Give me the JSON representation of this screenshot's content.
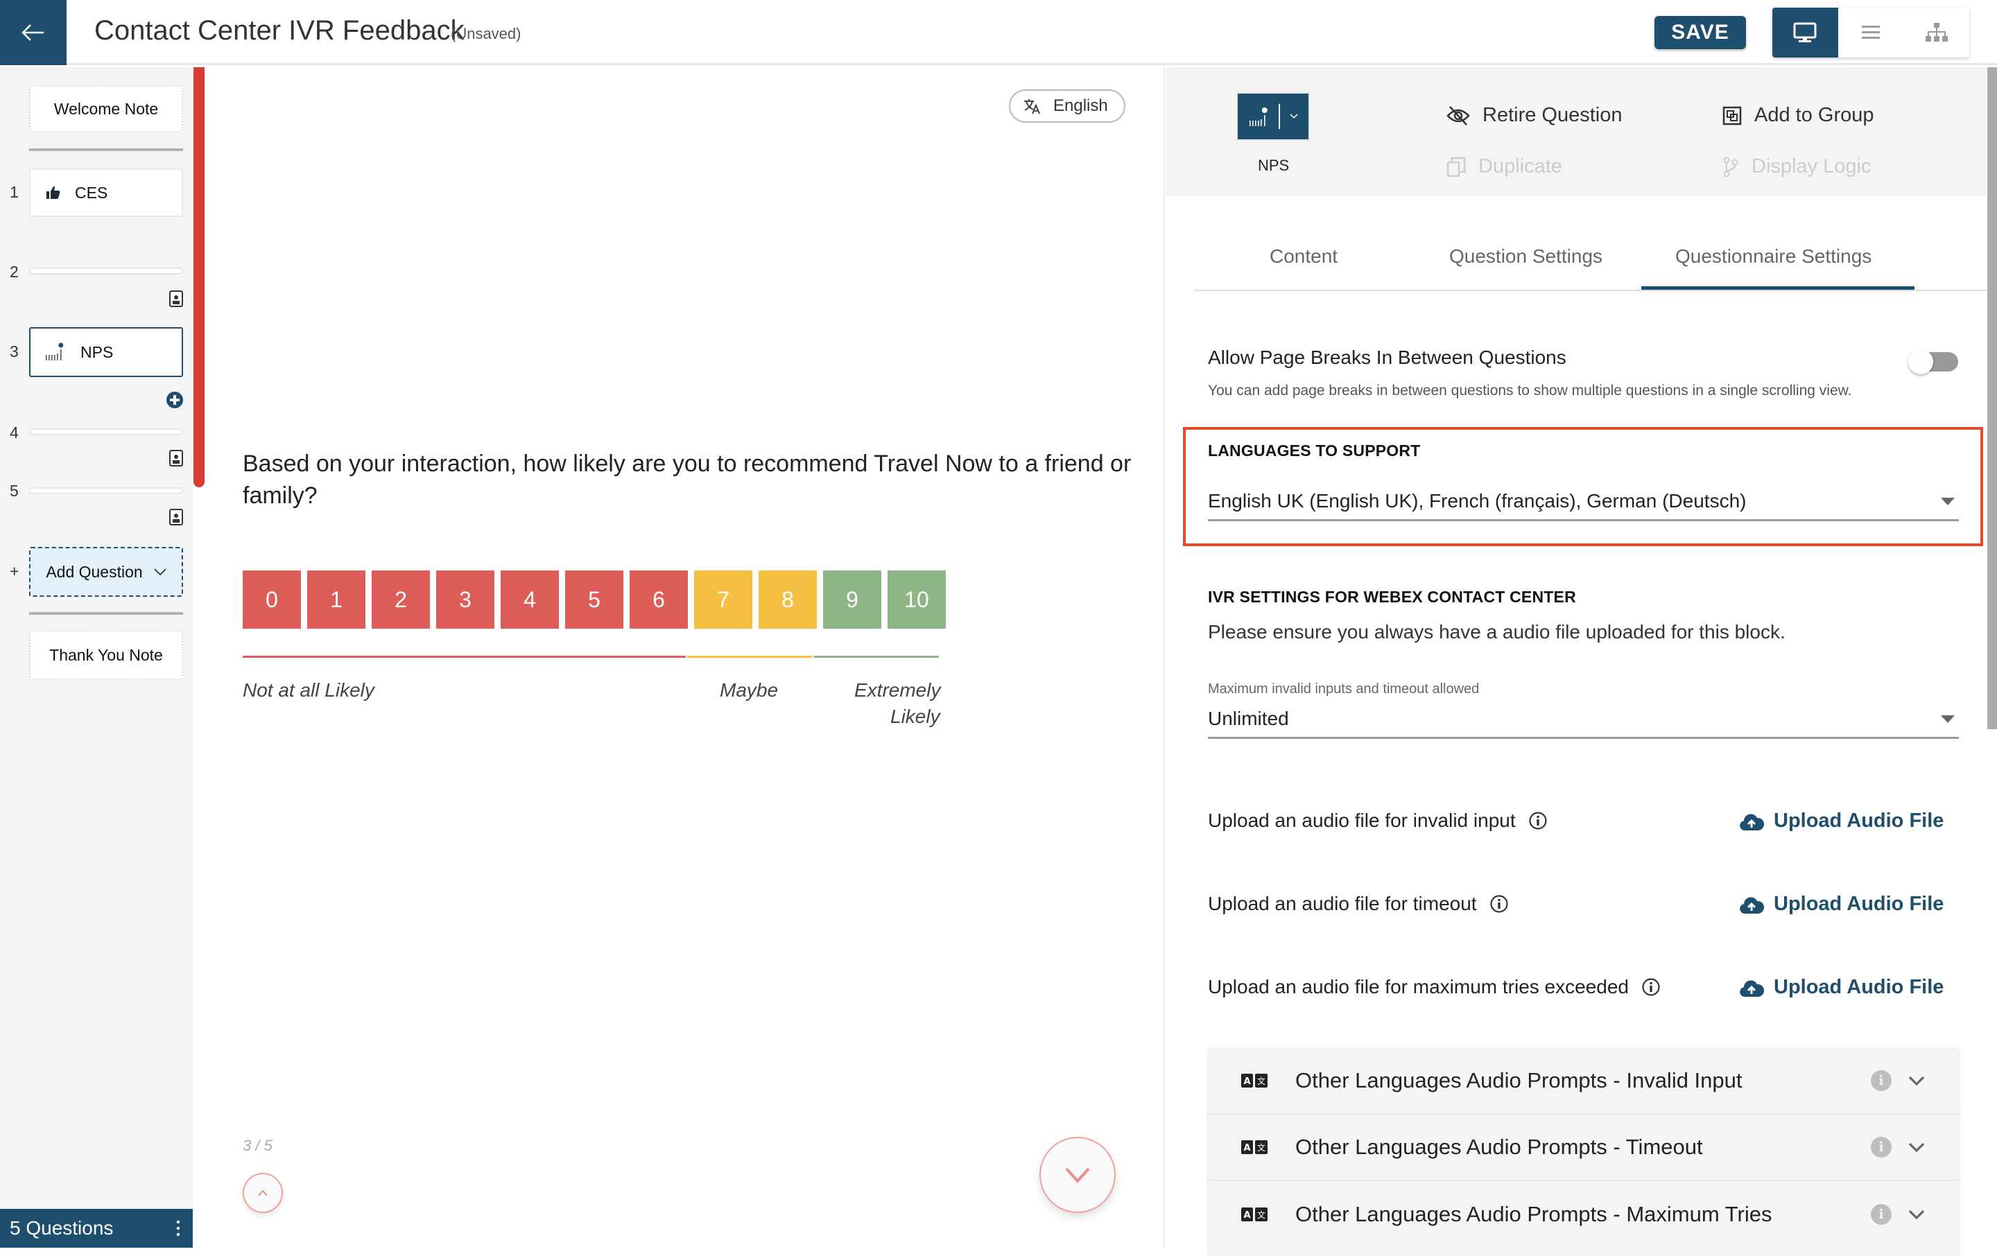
{
  "header": {
    "title": "Contact Center IVR Feedback",
    "status": "(Unsaved)",
    "save_label": "SAVE",
    "views": [
      "desktop-preview",
      "list-view",
      "hierarchy-view"
    ],
    "active_view": "desktop-preview"
  },
  "sidebar": {
    "welcome_note": "Welcome Note",
    "questions": [
      {
        "number": "1",
        "label": "CES",
        "icon": "thumbs-up-icon"
      },
      {
        "number": "2",
        "label": ""
      },
      {
        "number": "3",
        "label": "NPS",
        "icon": "nps-icon",
        "selected": true
      },
      {
        "number": "4",
        "label": ""
      },
      {
        "number": "5",
        "label": ""
      }
    ],
    "add_prefix": "+",
    "add_question": "Add Question",
    "thank_you_note": "Thank You Note",
    "footer_label": "5 Questions"
  },
  "progress": {
    "fraction": 0.6
  },
  "preview": {
    "language": "English",
    "question": "Based on your interaction, how likely are you to recommend Travel Now to a friend or family?",
    "scale": [
      {
        "value": "0",
        "group": "detractor"
      },
      {
        "value": "1",
        "group": "detractor"
      },
      {
        "value": "2",
        "group": "detractor"
      },
      {
        "value": "3",
        "group": "detractor"
      },
      {
        "value": "4",
        "group": "detractor"
      },
      {
        "value": "5",
        "group": "detractor"
      },
      {
        "value": "6",
        "group": "detractor"
      },
      {
        "value": "7",
        "group": "passive"
      },
      {
        "value": "8",
        "group": "passive"
      },
      {
        "value": "9",
        "group": "promoter"
      },
      {
        "value": "10",
        "group": "promoter"
      }
    ],
    "colors": {
      "detractor": "#de5d58",
      "passive": "#f5bf42",
      "promoter": "#8db585"
    },
    "labels": {
      "low": "Not at all Likely",
      "mid": "Maybe",
      "high_line1": "Extremely",
      "high_line2": "Likely"
    },
    "page_counter": "3 / 5"
  },
  "toolbar": {
    "question_type": "NPS",
    "retire": "Retire Question",
    "add_to_group": "Add to Group",
    "duplicate": "Duplicate",
    "display_logic": "Display Logic"
  },
  "tabs": [
    {
      "label": "Content",
      "active": false
    },
    {
      "label": "Question Settings",
      "active": false
    },
    {
      "label": "Questionnaire Settings",
      "active": true
    }
  ],
  "settings": {
    "page_breaks_title": "Allow Page Breaks In Between Questions",
    "page_breaks_help": "You can add page breaks in between questions to show multiple questions in a single scrolling view.",
    "page_breaks_enabled": false,
    "languages_heading": "LANGUAGES TO SUPPORT",
    "languages_value": "English UK (English UK), French (français), German (Deutsch)",
    "ivr_heading": "IVR SETTINGS FOR WEBEX CONTACT CENTER",
    "ivr_note": "Please ensure you always have a audio file uploaded for this block.",
    "max_invalid_label": "Maximum invalid inputs and timeout allowed",
    "max_invalid_value": "Unlimited",
    "uploads": [
      {
        "label": "Upload an audio file for invalid input",
        "action": "Upload Audio File"
      },
      {
        "label": "Upload an audio file for timeout",
        "action": "Upload Audio File"
      },
      {
        "label": "Upload an audio file for maximum tries exceeded",
        "action": "Upload Audio File"
      }
    ],
    "accordions": [
      {
        "label": "Other Languages Audio Prompts - Invalid Input"
      },
      {
        "label": "Other Languages Audio Prompts - Timeout"
      },
      {
        "label": "Other Languages Audio Prompts - Maximum Tries"
      }
    ]
  },
  "accent_color": "#1f4f6e",
  "highlight_color": "#e34a2e"
}
